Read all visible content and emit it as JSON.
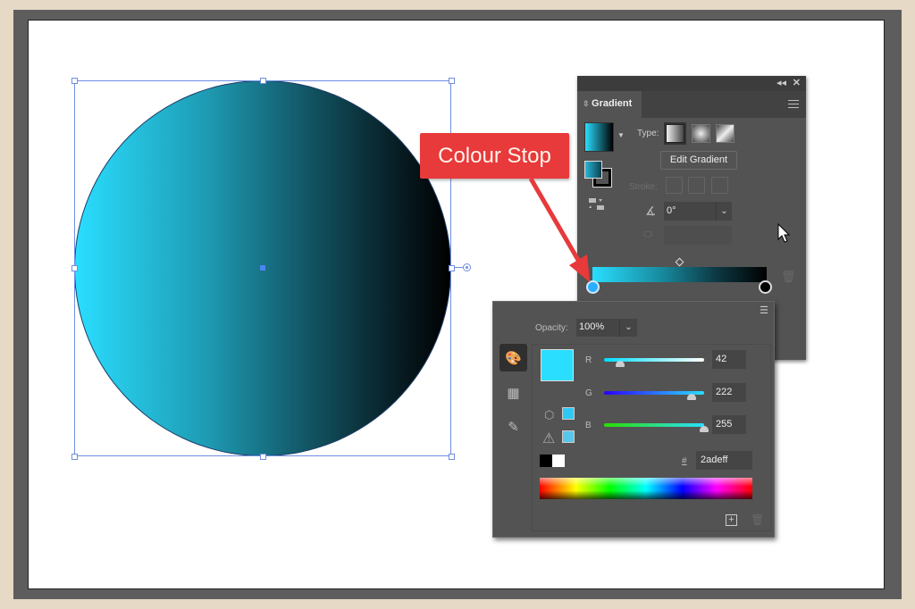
{
  "callout": {
    "label": "Colour Stop",
    "color": "#e8393b"
  },
  "artwork": {
    "shape": "circle",
    "gradient_start": "#2adeff",
    "gradient_end": "#000000",
    "selection_color": "#6e8fe0"
  },
  "gradient_panel": {
    "title": "Gradient",
    "collapse_icon": "double-chevron-icon",
    "close_icon": "close-icon",
    "type_label": "Type:",
    "types": [
      "linear",
      "radial",
      "freeform"
    ],
    "edit_gradient_label": "Edit Gradient",
    "stroke_label": "Stroke:",
    "angle_value": "0°",
    "aspect_value": "",
    "stops": [
      {
        "position": 0,
        "color": "#2adeff",
        "selected": true
      },
      {
        "position": 100,
        "color": "#000000",
        "selected": false
      }
    ]
  },
  "color_panel": {
    "opacity_label": "Opacity:",
    "opacity_value": "100%",
    "channels": [
      {
        "label": "R",
        "value": "42",
        "fraction": 0.165
      },
      {
        "label": "G",
        "value": "222",
        "fraction": 0.871
      },
      {
        "label": "B",
        "value": "255",
        "fraction": 1.0
      }
    ],
    "hex_label": "#",
    "hex_value": "2adeff",
    "swatch_color": "#2adeff"
  }
}
